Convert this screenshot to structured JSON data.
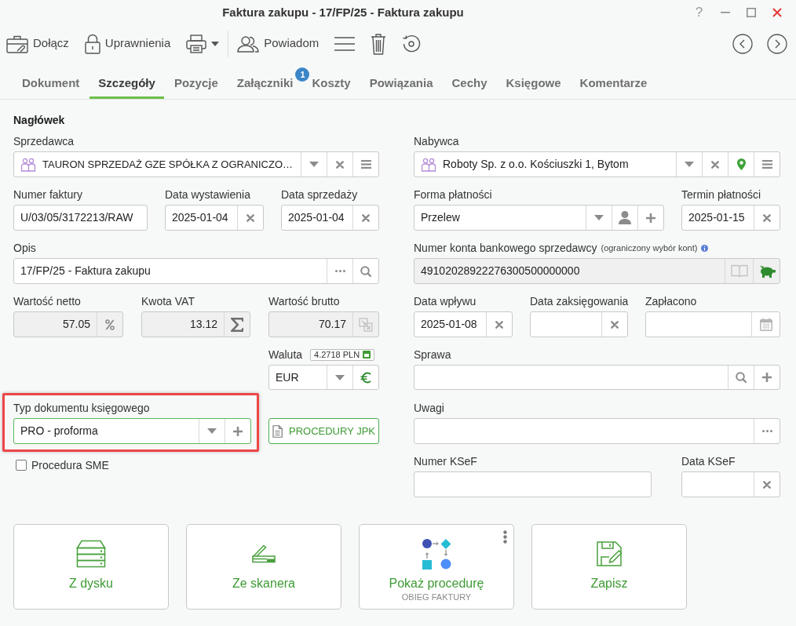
{
  "window": {
    "title": "Faktura zakupu - 17/FP/25 - Faktura zakupu",
    "help": "?"
  },
  "toolbar": {
    "attach": "Dołącz",
    "permissions": "Uprawnienia",
    "notify": "Powiadom"
  },
  "tabs": [
    {
      "label": "Dokument",
      "selected": false
    },
    {
      "label": "Szczegóły",
      "selected": true
    },
    {
      "label": "Pozycje",
      "selected": false
    },
    {
      "label": "Załączniki",
      "selected": false,
      "badge": "1"
    },
    {
      "label": "Koszty",
      "selected": false
    },
    {
      "label": "Powiązania",
      "selected": false
    },
    {
      "label": "Cechy",
      "selected": false
    },
    {
      "label": "Księgowe",
      "selected": false
    },
    {
      "label": "Komentarze",
      "selected": false
    }
  ],
  "form": {
    "section_title": "Nagłówek",
    "seller": {
      "label": "Sprzedawca",
      "value": "TAURON SPRZEDAŻ GZE SPÓŁKA Z OGRANICZO…"
    },
    "invoice_number": {
      "label": "Numer faktury",
      "value": "U/03/05/3172213/RAW"
    },
    "issue_date": {
      "label": "Data wystawienia",
      "value": "2025-01-04"
    },
    "sale_date": {
      "label": "Data sprzedaży",
      "value": "2025-01-04"
    },
    "description": {
      "label": "Opis",
      "value": "17/FP/25 - Faktura zakupu"
    },
    "net_value": {
      "label": "Wartość netto",
      "value": "57.05",
      "disabled": true
    },
    "vat_amount": {
      "label": "Kwota VAT",
      "value": "13.12",
      "disabled": true
    },
    "gross_value": {
      "label": "Wartość brutto",
      "value": "70.17",
      "disabled": true
    },
    "currency": {
      "label": "Waluta",
      "rate": "4.2718 PLN",
      "value": "EUR"
    },
    "document_type": {
      "label": "Typ dokumentu księgowego",
      "value": "PRO - proforma",
      "focused": true,
      "highlighted": true
    },
    "jpk_button": "PROCEDURY JPK",
    "sme_procedure": {
      "label": "Procedura SME",
      "checked": false
    },
    "buyer": {
      "label": "Nabywca",
      "value": "Roboty Sp. z o.o. Kościuszki 1, Bytom"
    },
    "payment_method": {
      "label": "Forma płatności",
      "value": "Przelew"
    },
    "payment_due": {
      "label": "Termin płatności",
      "value": "2025-01-15"
    },
    "bank_account": {
      "label": "Numer konta bankowego sprzedawcy",
      "note": "(ograniczony wybór kont)",
      "value": "49102028922276300500000000",
      "disabled": true
    },
    "receipt_date": {
      "label": "Data wpływu",
      "value": "2025-01-08"
    },
    "posting_date": {
      "label": "Data zaksięgowania"
    },
    "paid": {
      "label": "Zapłacono"
    },
    "case": {
      "label": "Sprawa"
    },
    "notes": {
      "label": "Uwagi"
    },
    "ksef_number": {
      "label": "Numer KSeF"
    },
    "ksef_date": {
      "label": "Data KSeF"
    }
  },
  "tiles": [
    {
      "kind": "disk",
      "label": "Z dysku",
      "menu": false
    },
    {
      "kind": "scanner",
      "label": "Ze skanera",
      "menu": false
    },
    {
      "kind": "procedure",
      "label": "Pokaż procedurę",
      "caption": "OBIEG FAKTURY",
      "menu": true
    },
    {
      "kind": "save",
      "label": "Zapisz",
      "menu": false
    }
  ]
}
